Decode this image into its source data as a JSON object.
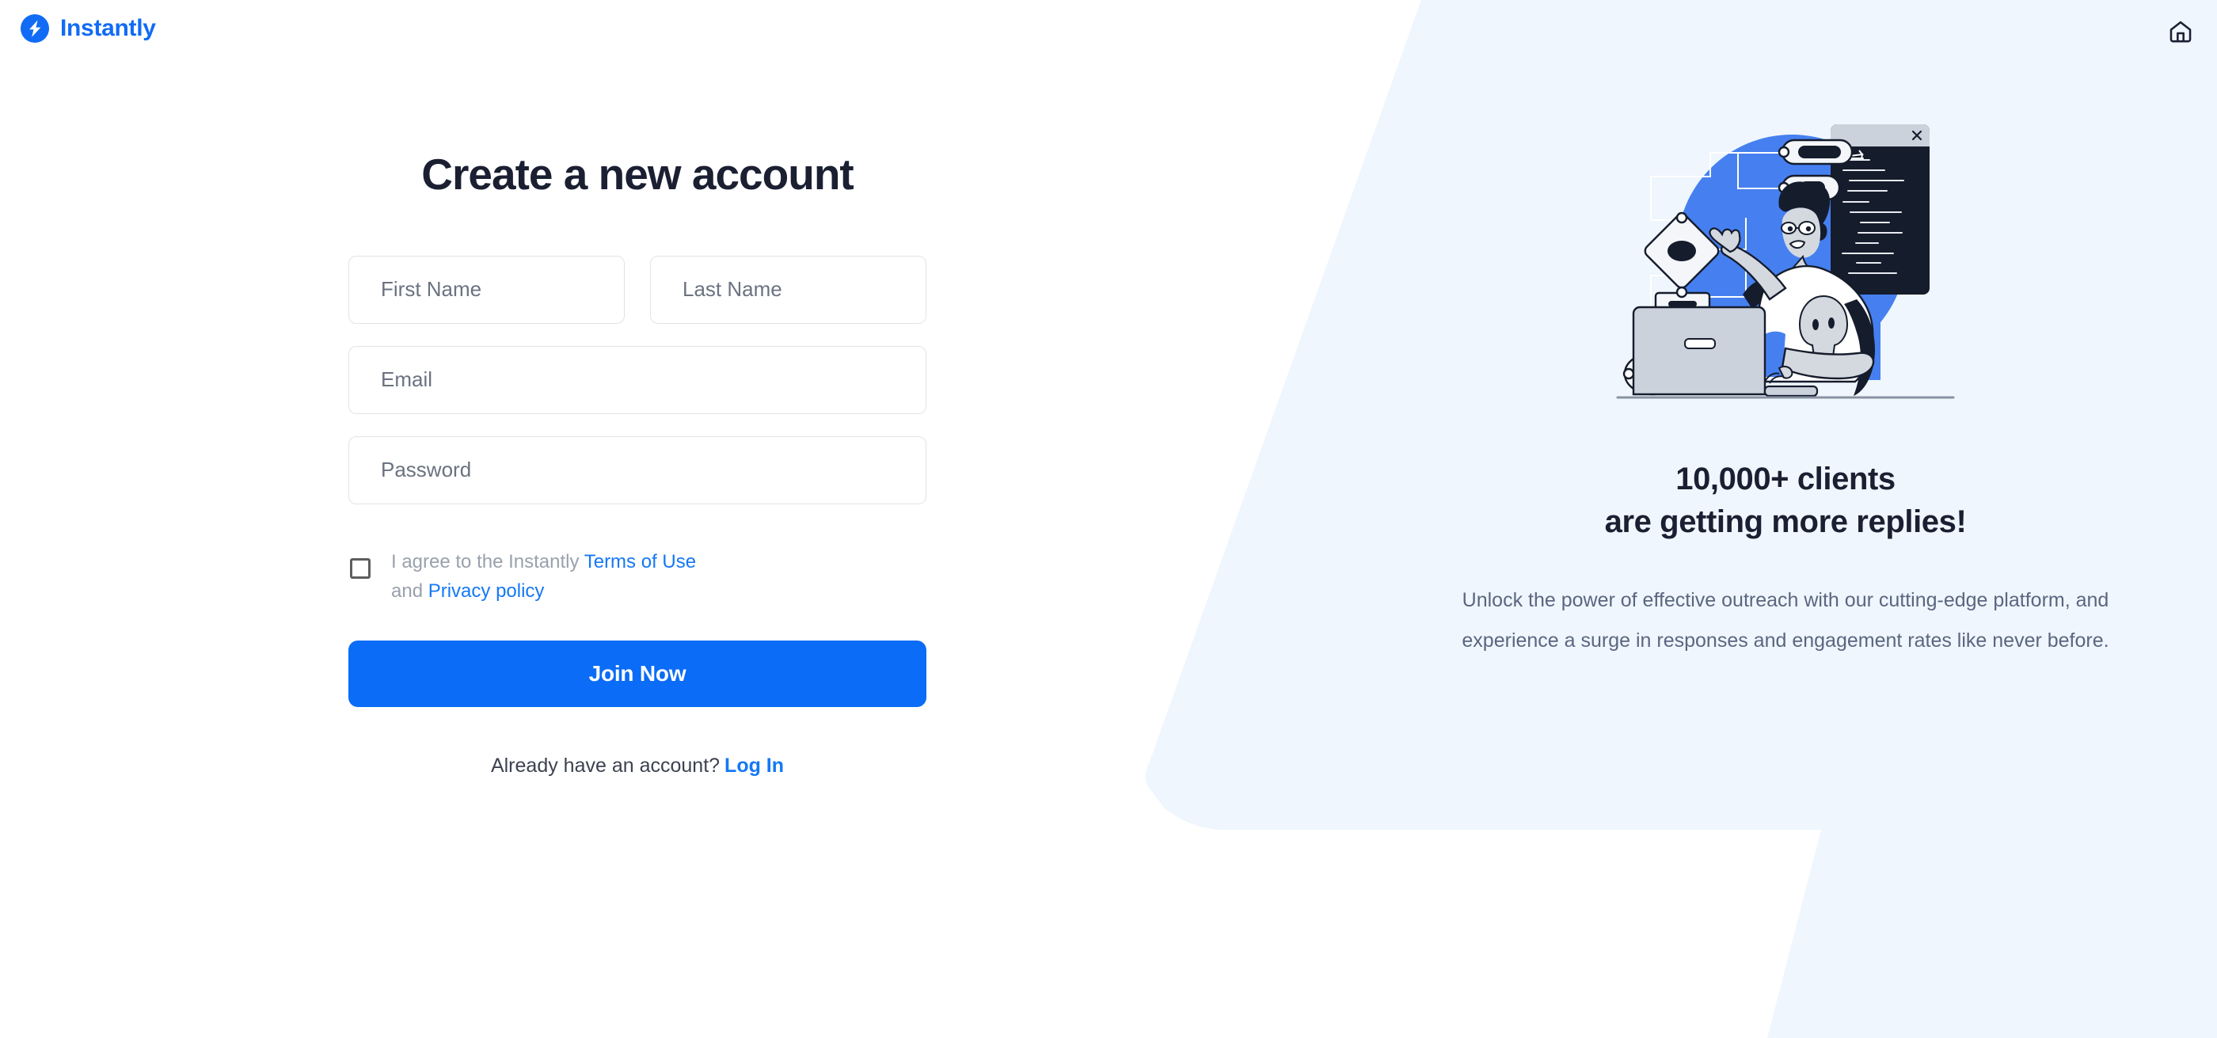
{
  "brand": {
    "name": "Instantly",
    "logo_icon": "lightning-bolt-icon",
    "logo_color": "#116BF5"
  },
  "header": {
    "home_icon": "home-icon"
  },
  "form": {
    "title": "Create a new account",
    "fields": {
      "first_name_placeholder": "First Name",
      "last_name_placeholder": "Last Name",
      "email_placeholder": "Email",
      "password_placeholder": "Password"
    },
    "terms": {
      "prefix": "I agree to the Instantly ",
      "terms_link": "Terms of Use",
      "middle": " and ",
      "privacy_link": "Privacy policy",
      "checked": false
    },
    "submit_label": "Join Now",
    "submit_color": "#0A6CF7",
    "footer": {
      "text": "Already have an account?",
      "link": "Log In"
    }
  },
  "promo": {
    "illustration_icon": "person-at-laptop-workflow-illustration",
    "headline_line1": "10,000+ clients",
    "headline_line2": "are getting more replies!",
    "body": "Unlock the power of effective outreach with our cutting-edge platform, and experience a surge in responses and engagement rates like never before.",
    "panel_color": "#EFF6FD",
    "accent_blue": "#4680F0"
  }
}
